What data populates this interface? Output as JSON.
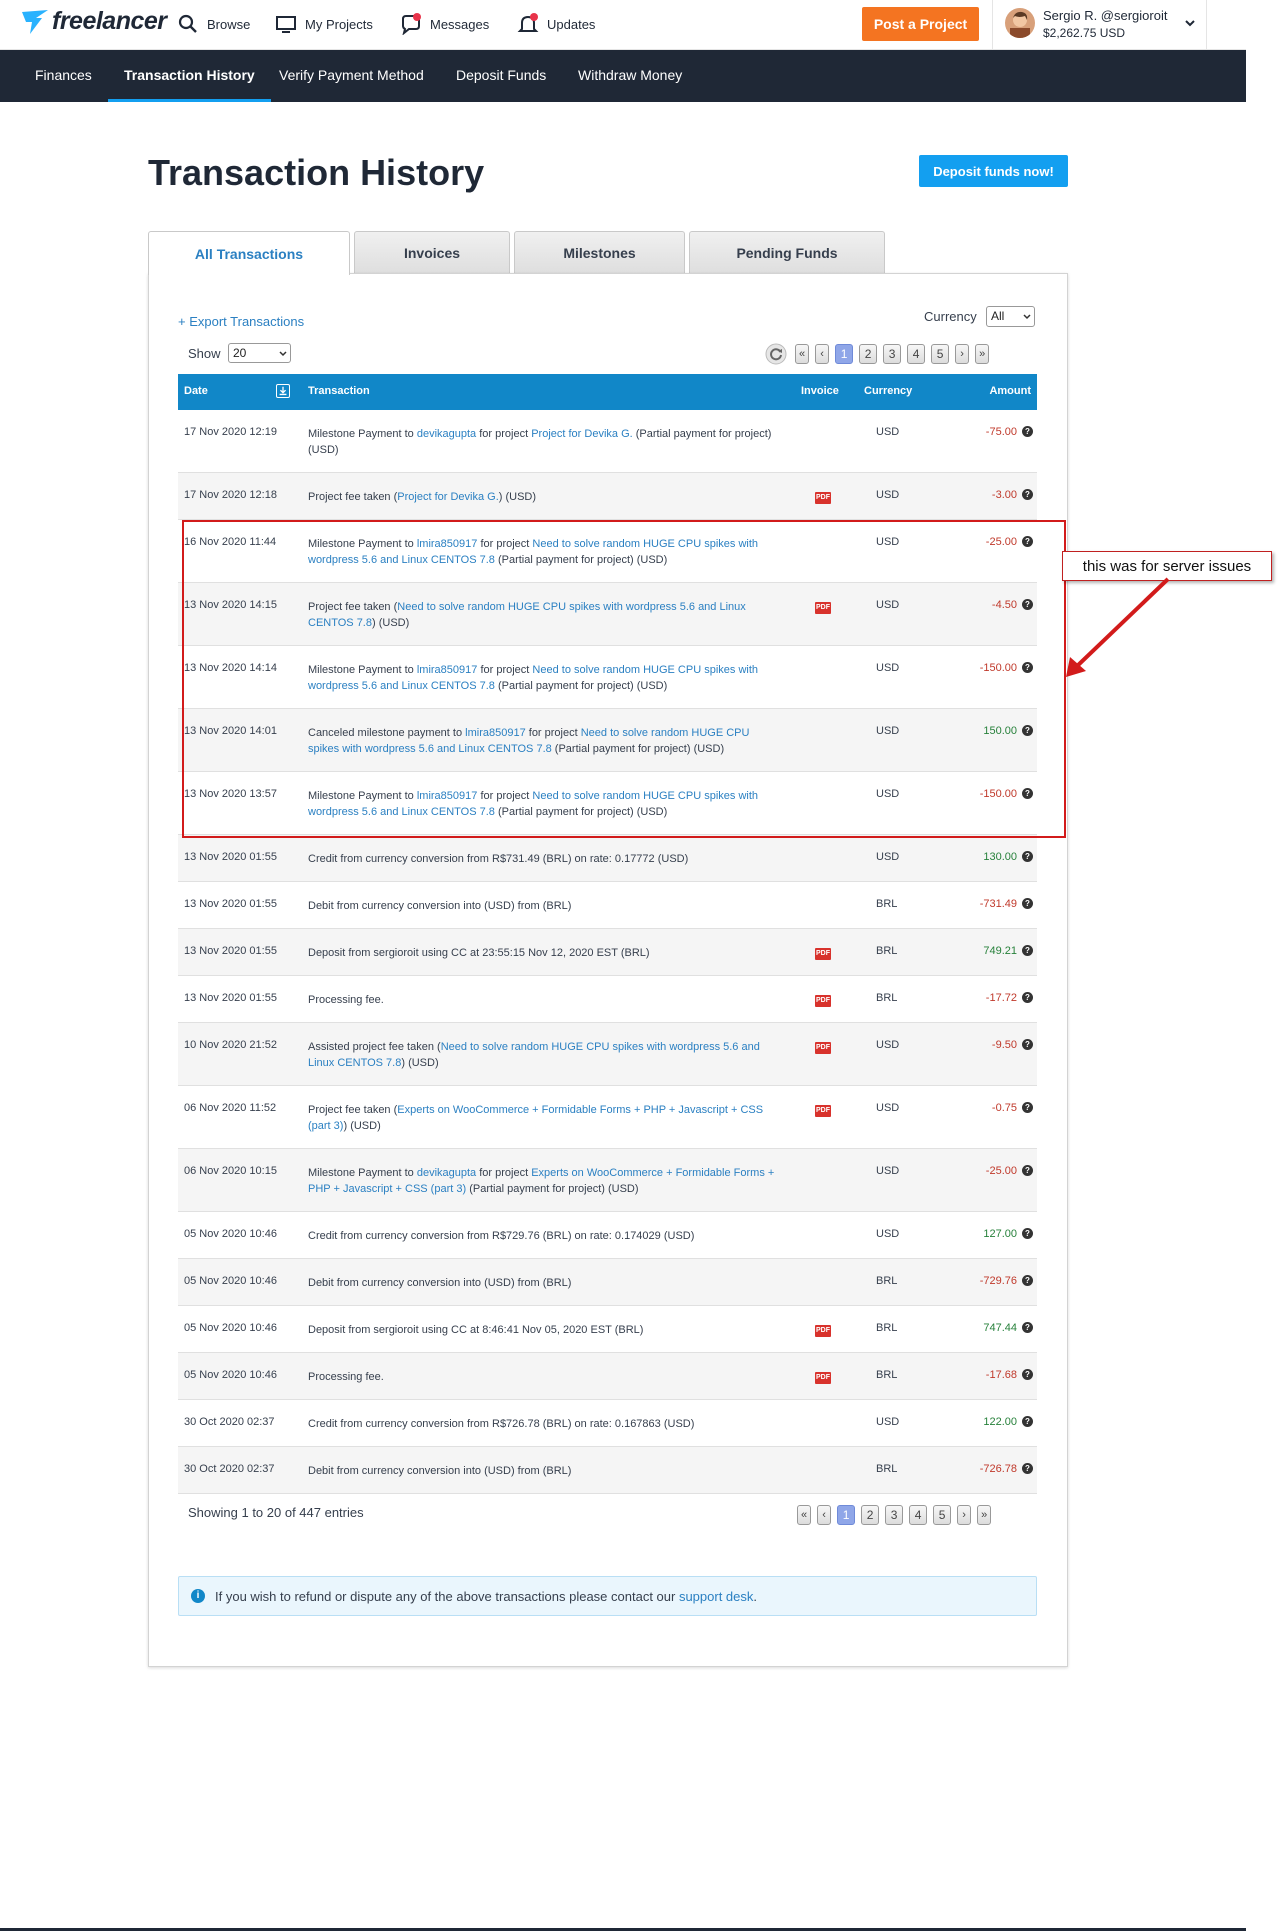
{
  "brand": {
    "logo_text": "freelancer"
  },
  "topnav": {
    "browse": "Browse",
    "my_projects": "My Projects",
    "messages": "Messages",
    "updates": "Updates",
    "post_project": "Post a Project",
    "user_name": "Sergio R. @sergioroit",
    "user_balance": "$2,262.75 USD"
  },
  "subnav": {
    "finances": "Finances",
    "transaction_history": "Transaction History",
    "verify_payment": "Verify Payment Method",
    "deposit_funds": "Deposit Funds",
    "withdraw_money": "Withdraw Money"
  },
  "page": {
    "title": "Transaction History",
    "deposit_button": "Deposit funds now!"
  },
  "tabs": {
    "all": "All Transactions",
    "invoices": "Invoices",
    "milestones": "Milestones",
    "pending": "Pending Funds"
  },
  "controls": {
    "export": "+ Export Transactions",
    "currency_label": "Currency",
    "currency_value": "All",
    "show_label": "Show",
    "show_value": "20"
  },
  "pagination": {
    "first": "«",
    "prev": "‹",
    "pages": [
      "1",
      "2",
      "3",
      "4",
      "5"
    ],
    "next": "›",
    "last": "»",
    "current": "1"
  },
  "table": {
    "headers": {
      "date": "Date",
      "transaction": "Transaction",
      "invoice": "Invoice",
      "currency": "Currency",
      "amount": "Amount"
    },
    "rows": [
      {
        "date": "17 Nov 2020 12:19",
        "parts": [
          [
            "t",
            "Milestone Payment to "
          ],
          [
            "l",
            "devikagupta"
          ],
          [
            "t",
            " for project "
          ],
          [
            "l",
            "Project for Devika G."
          ],
          [
            "t",
            " (Partial payment for project) (USD)"
          ]
        ],
        "pdf": false,
        "currency": "USD",
        "amount": "-75.00",
        "sign": "neg"
      },
      {
        "date": "17 Nov 2020 12:18",
        "parts": [
          [
            "t",
            "Project fee taken ("
          ],
          [
            "l",
            "Project for Devika G."
          ],
          [
            "t",
            ") (USD)"
          ]
        ],
        "pdf": true,
        "currency": "USD",
        "amount": "-3.00",
        "sign": "neg"
      },
      {
        "date": "16 Nov 2020 11:44",
        "parts": [
          [
            "t",
            "Milestone Payment to "
          ],
          [
            "l",
            "lmira850917"
          ],
          [
            "t",
            " for project "
          ],
          [
            "l",
            "Need to solve random HUGE CPU spikes with wordpress 5.6 and Linux CENTOS 7.8"
          ],
          [
            "t",
            " (Partial payment for project) (USD)"
          ]
        ],
        "pdf": false,
        "currency": "USD",
        "amount": "-25.00",
        "sign": "neg"
      },
      {
        "date": "13 Nov 2020 14:15",
        "parts": [
          [
            "t",
            "Project fee taken ("
          ],
          [
            "l",
            "Need to solve random HUGE CPU spikes with wordpress 5.6 and Linux CENTOS 7.8"
          ],
          [
            "t",
            ") (USD)"
          ]
        ],
        "pdf": true,
        "currency": "USD",
        "amount": "-4.50",
        "sign": "neg"
      },
      {
        "date": "13 Nov 2020 14:14",
        "parts": [
          [
            "t",
            "Milestone Payment to "
          ],
          [
            "l",
            "lmira850917"
          ],
          [
            "t",
            " for project "
          ],
          [
            "l",
            "Need to solve random HUGE CPU spikes with wordpress 5.6 and Linux CENTOS 7.8"
          ],
          [
            "t",
            " (Partial payment for project) (USD)"
          ]
        ],
        "pdf": false,
        "currency": "USD",
        "amount": "-150.00",
        "sign": "neg"
      },
      {
        "date": "13 Nov 2020 14:01",
        "parts": [
          [
            "t",
            "Canceled milestone payment to "
          ],
          [
            "l",
            "lmira850917"
          ],
          [
            "t",
            " for project "
          ],
          [
            "l",
            "Need to solve random HUGE CPU spikes with wordpress 5.6 and Linux CENTOS 7.8"
          ],
          [
            "t",
            " (Partial payment for project) (USD)"
          ]
        ],
        "pdf": false,
        "currency": "USD",
        "amount": "150.00",
        "sign": "pos"
      },
      {
        "date": "13 Nov 2020 13:57",
        "parts": [
          [
            "t",
            "Milestone Payment to "
          ],
          [
            "l",
            "lmira850917"
          ],
          [
            "t",
            " for project "
          ],
          [
            "l",
            "Need to solve random HUGE CPU spikes with wordpress 5.6 and Linux CENTOS 7.8"
          ],
          [
            "t",
            " (Partial payment for project) (USD)"
          ]
        ],
        "pdf": false,
        "currency": "USD",
        "amount": "-150.00",
        "sign": "neg"
      },
      {
        "date": "13 Nov 2020 01:55",
        "parts": [
          [
            "t",
            "Credit from currency conversion from R$731.49 (BRL) on rate: 0.17772 (USD)"
          ]
        ],
        "pdf": false,
        "currency": "USD",
        "amount": "130.00",
        "sign": "pos"
      },
      {
        "date": "13 Nov 2020 01:55",
        "parts": [
          [
            "t",
            "Debit from currency conversion into (USD) from (BRL)"
          ]
        ],
        "pdf": false,
        "currency": "BRL",
        "amount": "-731.49",
        "sign": "neg"
      },
      {
        "date": "13 Nov 2020 01:55",
        "parts": [
          [
            "t",
            "Deposit from sergioroit using CC at 23:55:15 Nov 12, 2020 EST (BRL)"
          ]
        ],
        "pdf": true,
        "currency": "BRL",
        "amount": "749.21",
        "sign": "pos"
      },
      {
        "date": "13 Nov 2020 01:55",
        "parts": [
          [
            "t",
            "Processing fee."
          ]
        ],
        "pdf": true,
        "currency": "BRL",
        "amount": "-17.72",
        "sign": "neg"
      },
      {
        "date": "10 Nov 2020 21:52",
        "parts": [
          [
            "t",
            "Assisted project fee taken ("
          ],
          [
            "l",
            "Need to solve random HUGE CPU spikes with wordpress 5.6 and Linux CENTOS 7.8"
          ],
          [
            "t",
            ") (USD)"
          ]
        ],
        "pdf": true,
        "currency": "USD",
        "amount": "-9.50",
        "sign": "neg"
      },
      {
        "date": "06 Nov 2020 11:52",
        "parts": [
          [
            "t",
            "Project fee taken ("
          ],
          [
            "l",
            "Experts on WooCommerce + Formidable Forms + PHP + Javascript + CSS (part 3)"
          ],
          [
            "t",
            ") (USD)"
          ]
        ],
        "pdf": true,
        "currency": "USD",
        "amount": "-0.75",
        "sign": "neg"
      },
      {
        "date": "06 Nov 2020 10:15",
        "parts": [
          [
            "t",
            "Milestone Payment to "
          ],
          [
            "l",
            "devikagupta"
          ],
          [
            "t",
            " for project "
          ],
          [
            "l",
            "Experts on WooCommerce + Formidable Forms + PHP + Javascript + CSS (part 3)"
          ],
          [
            "t",
            " (Partial payment for project) (USD)"
          ]
        ],
        "pdf": false,
        "currency": "USD",
        "amount": "-25.00",
        "sign": "neg"
      },
      {
        "date": "05 Nov 2020 10:46",
        "parts": [
          [
            "t",
            "Credit from currency conversion from R$729.76 (BRL) on rate: 0.174029 (USD)"
          ]
        ],
        "pdf": false,
        "currency": "USD",
        "amount": "127.00",
        "sign": "pos"
      },
      {
        "date": "05 Nov 2020 10:46",
        "parts": [
          [
            "t",
            "Debit from currency conversion into (USD) from (BRL)"
          ]
        ],
        "pdf": false,
        "currency": "BRL",
        "amount": "-729.76",
        "sign": "neg"
      },
      {
        "date": "05 Nov 2020 10:46",
        "parts": [
          [
            "t",
            "Deposit from sergioroit using CC at 8:46:41 Nov 05, 2020 EST (BRL)"
          ]
        ],
        "pdf": true,
        "currency": "BRL",
        "amount": "747.44",
        "sign": "pos"
      },
      {
        "date": "05 Nov 2020 10:46",
        "parts": [
          [
            "t",
            "Processing fee."
          ]
        ],
        "pdf": true,
        "currency": "BRL",
        "amount": "-17.68",
        "sign": "neg"
      },
      {
        "date": "30 Oct 2020 02:37",
        "parts": [
          [
            "t",
            "Credit from currency conversion from R$726.78 (BRL) on rate: 0.167863 (USD)"
          ]
        ],
        "pdf": false,
        "currency": "USD",
        "amount": "122.00",
        "sign": "pos"
      },
      {
        "date": "30 Oct 2020 02:37",
        "parts": [
          [
            "t",
            "Debit from currency conversion into (USD) from (BRL)"
          ]
        ],
        "pdf": false,
        "currency": "BRL",
        "amount": "-726.78",
        "sign": "neg"
      }
    ]
  },
  "footer": {
    "showing": "Showing 1 to 20 of 447 entries",
    "info_text": "If you wish to refund or dispute any of the above transactions please contact our ",
    "info_link": "support desk",
    "info_end": "."
  },
  "annotation": {
    "callout": "this was for server issues"
  },
  "icons": {
    "pdf_label": "PDF",
    "help": "?",
    "info": "i"
  },
  "colors": {
    "brand_dark": "#1f2836",
    "accent_blue": "#139ff0",
    "table_header": "#1187c8",
    "post_orange": "#f47421",
    "negative": "#c0392b",
    "positive": "#27813b",
    "annotation_red": "#d21b1b"
  }
}
